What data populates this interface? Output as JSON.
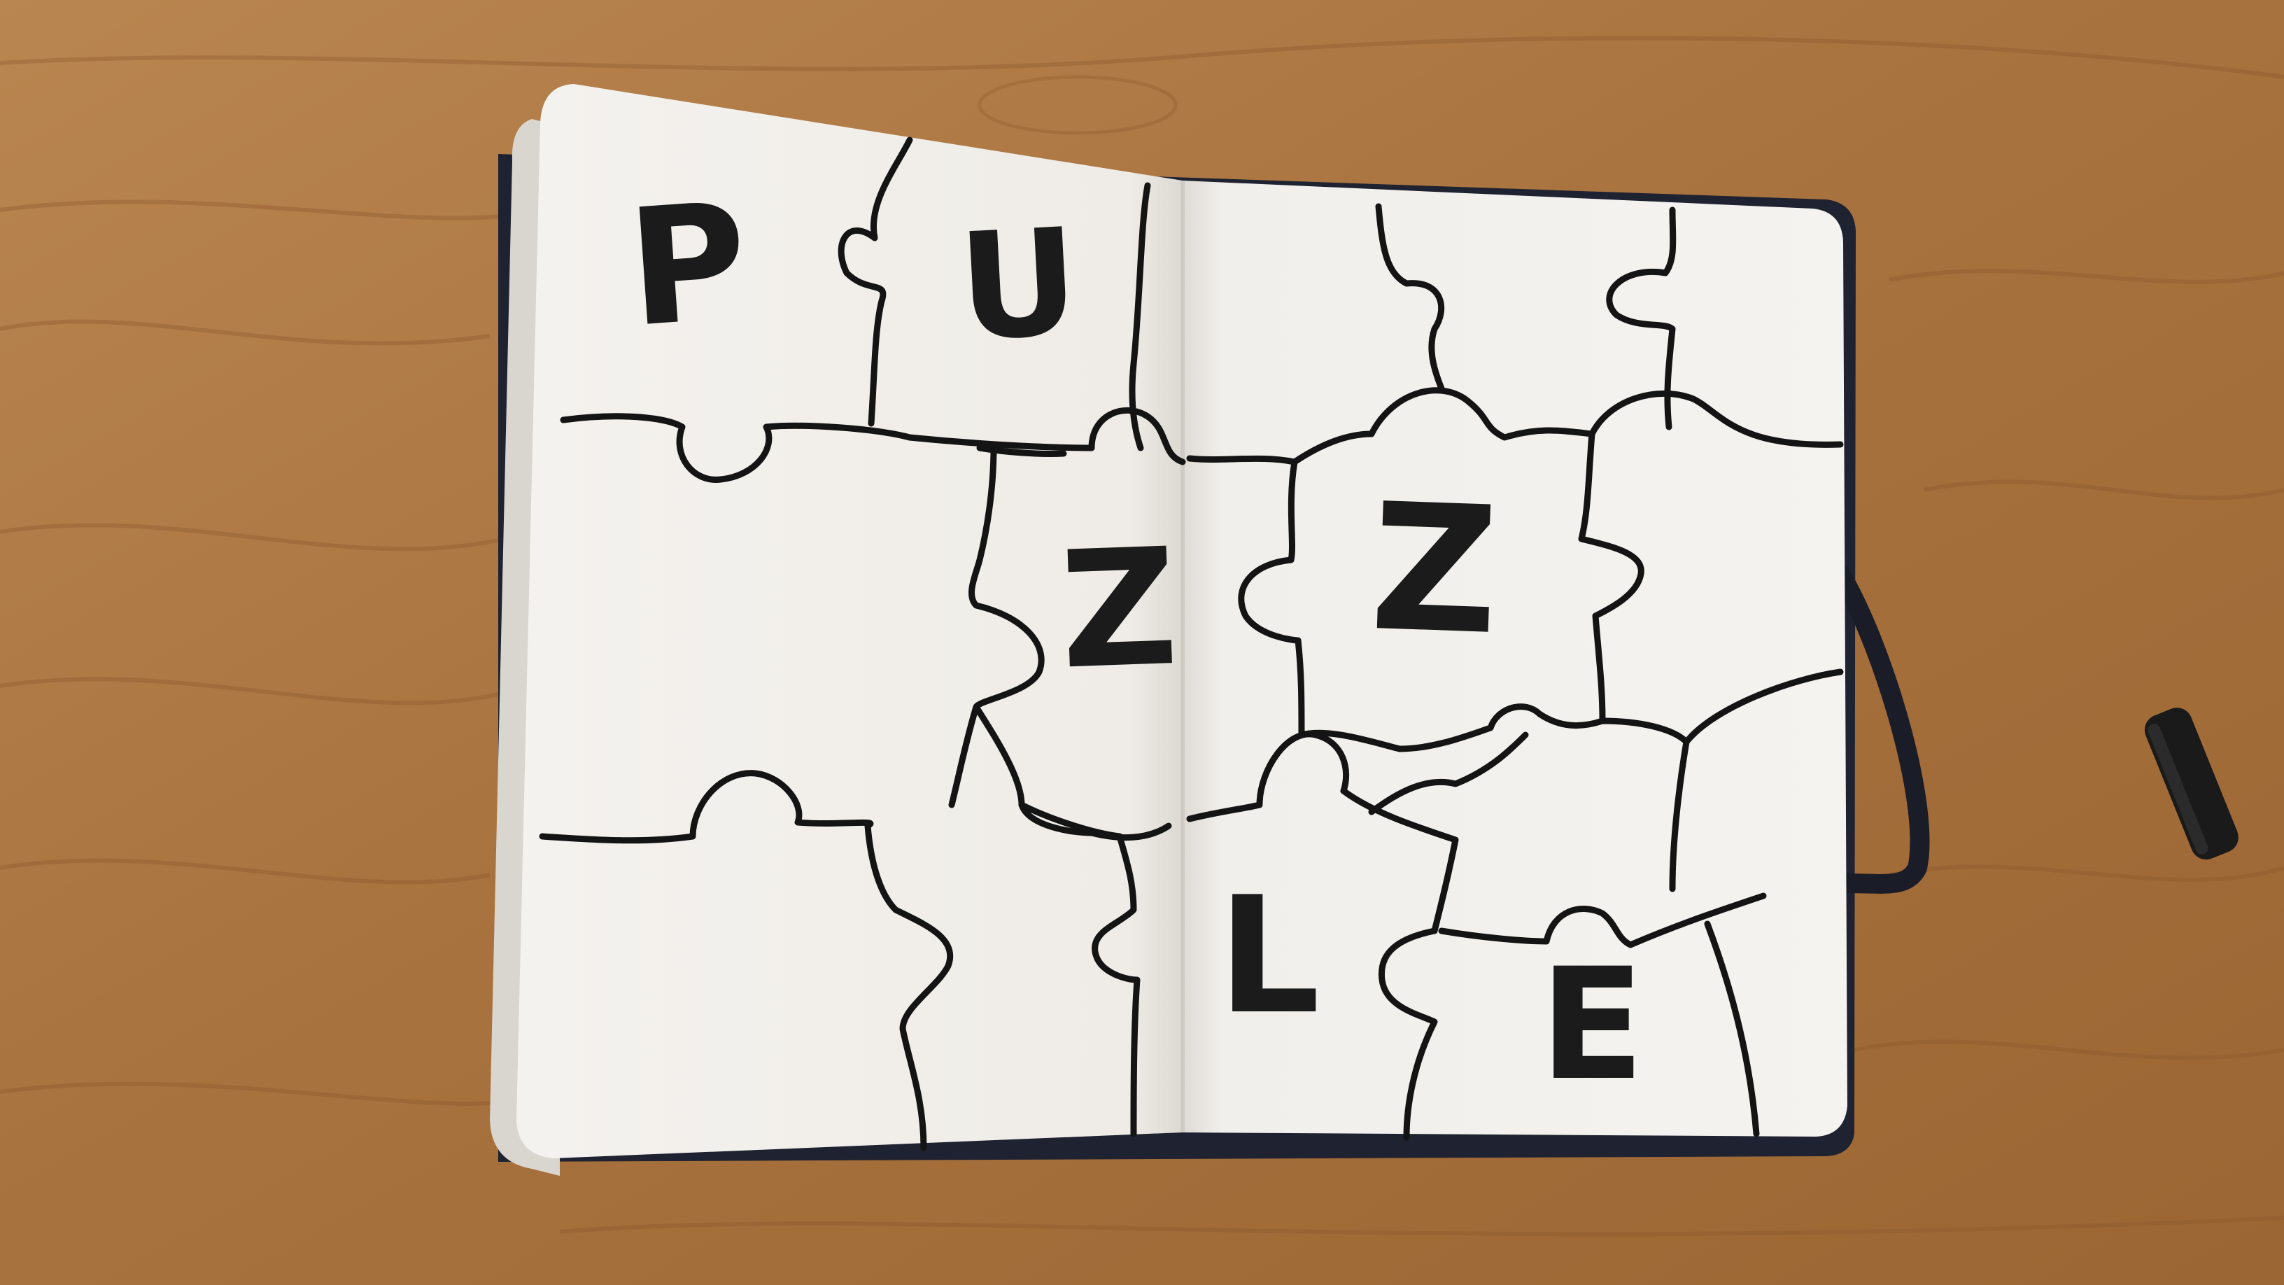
{
  "scene": {
    "description_kind": "photo",
    "colors": {
      "table": "#b07a45",
      "table_grain": "#8f5a2c",
      "paper": "#f3f1ed",
      "ink": "#141414",
      "notebook_cover": "#1f2230",
      "chalk": "#1a1a1a"
    },
    "letters": [
      "P",
      "U",
      "Z",
      "Z",
      "L",
      "E"
    ]
  }
}
